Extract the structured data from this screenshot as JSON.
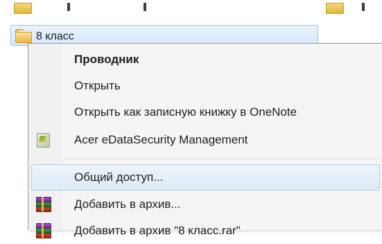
{
  "folder": {
    "name": "8 класс"
  },
  "context_menu": {
    "items": [
      {
        "label": "Проводник",
        "bold": true,
        "icon": null
      },
      {
        "label": "Открыть",
        "bold": false,
        "icon": null
      },
      {
        "label": "Открыть как записную книжку в OneNote",
        "bold": false,
        "icon": null
      },
      {
        "label": "Acer eDataSecurity Management",
        "bold": false,
        "icon": "acer-edatasecurity-icon"
      },
      {
        "label": "Общий доступ...",
        "bold": false,
        "icon": null,
        "highlighted": true
      },
      {
        "label": "Добавить в архив...",
        "bold": false,
        "icon": "winrar-icon"
      },
      {
        "label": "Добавить в архив \"8 класс.rar\"",
        "bold": false,
        "icon": "winrar-icon"
      }
    ]
  },
  "colors": {
    "selection_fill": "#d7e8fb",
    "selection_border": "#99c2ee",
    "menu_background": "#f5f5f5",
    "hover_border": "#b6cde6"
  }
}
